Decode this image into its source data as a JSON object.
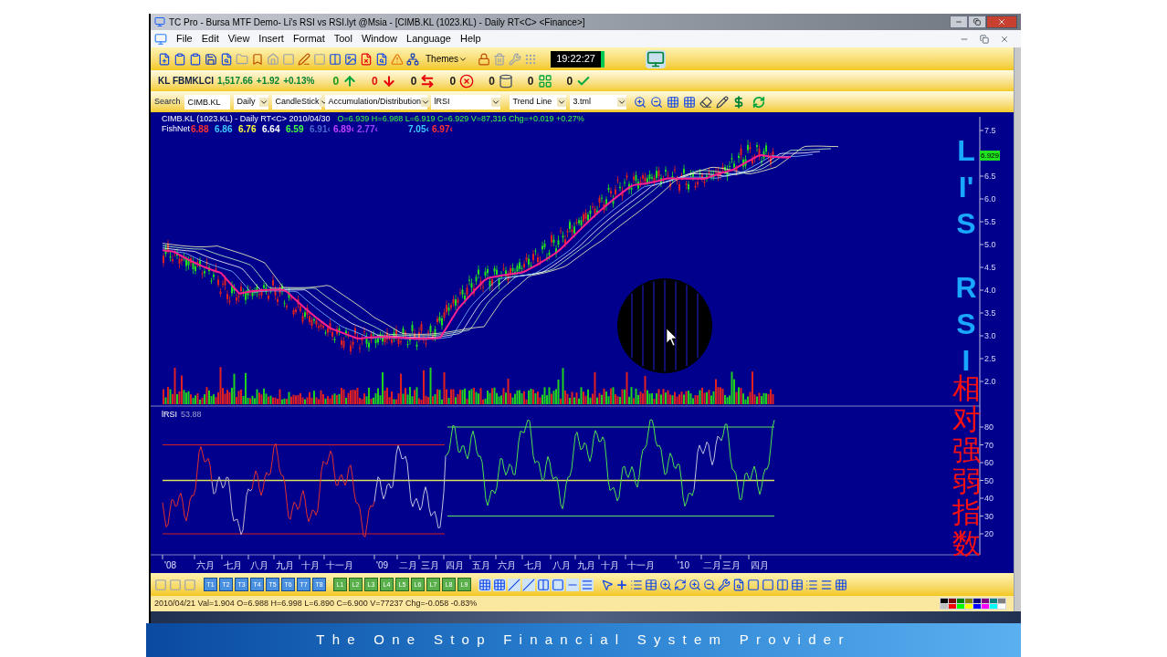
{
  "window": {
    "title": "TC Pro - Bursa MTF Demo- Li's RSI vs RSI.lyt @Msia - [CIMB.KL (1023.KL) - Daily RT<C> <Finance>]"
  },
  "menu": [
    "File",
    "Edit",
    "View",
    "Insert",
    "Format",
    "Tool",
    "Window",
    "Language",
    "Help"
  ],
  "toolbar": {
    "themes_label": "Themes",
    "clock": "19:22:27"
  },
  "ticker": {
    "index": "KL FBMKLCI",
    "value": "1,517.66",
    "change": "+1.92",
    "percent": "+0.13%",
    "counters": [
      {
        "count": "0",
        "kind": "up",
        "color": "#1a9a1a"
      },
      {
        "count": "0",
        "kind": "down",
        "color": "#e01010"
      },
      {
        "count": "0",
        "kind": "swap",
        "color": "#202020"
      },
      {
        "count": "0",
        "kind": "cancel",
        "color": "#202020"
      },
      {
        "count": "0",
        "kind": "can",
        "color": "#202020"
      },
      {
        "count": "0",
        "kind": "tile",
        "color": "#202020"
      },
      {
        "count": "0",
        "kind": "check",
        "color": "#202020"
      }
    ]
  },
  "chart_bar": {
    "search_label": "Search",
    "symbol": "CIMB.KL",
    "selects": [
      "Daily",
      "CandleStick",
      "Accumulation/Distribution",
      "lRSI",
      "Trend Line",
      "3.tml"
    ]
  },
  "chart": {
    "header": "CIMB.KL (1023.KL) - Daily RT<C>  2010/04/30",
    "quote": "O=6.939  H=6.988  L=6.919  C=6.929  V=87,316  Chg=+0.019  +0.27%",
    "fishnet_label": "FishNet",
    "fishnet_values": [
      {
        "text": "6.88",
        "color": "#ff3030"
      },
      {
        "text": "6.86",
        "color": "#40c8ff"
      },
      {
        "text": "6.76",
        "color": "#ffff40"
      },
      {
        "text": "6.64",
        "color": "#ffffff"
      },
      {
        "text": "6.59",
        "color": "#40ff40"
      },
      {
        "text": "6.91‹",
        "color": "#4a6ad0"
      },
      {
        "text": "6.89‹",
        "color": "#c040ff"
      },
      {
        "text": "2.77‹",
        "color": "#a040ff"
      },
      {
        "text": "7.05‹",
        "color": "#40c8ff"
      },
      {
        "text": "6.97‹",
        "color": "#ff3030"
      }
    ],
    "rsi_label": "lRSI",
    "rsi_value": "53.88",
    "price_ticks": [
      "7.5",
      "6.5",
      "6.0",
      "5.5",
      "5.0",
      "4.5",
      "4.0",
      "3.5",
      "3.0",
      "2.5",
      "2.0"
    ],
    "last_price": "6.929",
    "rsi_ticks": [
      "80",
      "70",
      "60",
      "50",
      "40",
      "30",
      "20"
    ],
    "x_labels": [
      "'08",
      "六月",
      "七月",
      "八月",
      "九月",
      "十月",
      "十一月",
      "'09",
      "二月",
      "三月",
      "四月",
      "五月",
      "六月",
      "七月",
      "八月",
      "九月",
      "十月",
      "十一月",
      "'10",
      "二月",
      "三月",
      "四月"
    ],
    "overlay_title": {
      "groups": [
        [
          "L",
          "I'",
          "S"
        ],
        [
          "R",
          "S",
          "I"
        ]
      ],
      "chinese": "相对强弱指数"
    }
  },
  "bottom_toolbar": {
    "t_buttons": [
      "T1",
      "T2",
      "T3",
      "T4",
      "T5",
      "T6",
      "T7",
      "T8"
    ],
    "l_buttons": [
      "L1",
      "L2",
      "L3",
      "L4",
      "L5",
      "L6",
      "L7",
      "L8",
      "L9"
    ]
  },
  "status_bar": {
    "text": "2010/04/21  Val=1.904  O=6.988  H=6.998  L=6.890  C=6.900  V=77237  Chg=-0.058  -0.83%",
    "palette": [
      {
        "color": "#000000"
      },
      {
        "color": "#800000"
      },
      {
        "color": "#008000"
      },
      {
        "color": "#808000"
      },
      {
        "color": "#000080"
      },
      {
        "color": "#800080"
      },
      {
        "color": "#008080"
      },
      {
        "color": "#808080"
      },
      {
        "color": "#c0c0c0"
      },
      {
        "color": "#ff0000"
      },
      {
        "color": "#00ff00"
      },
      {
        "color": "#ffff00"
      },
      {
        "color": "#0000ff"
      },
      {
        "color": "#ff00ff"
      },
      {
        "color": "#00ffff"
      },
      {
        "color": "#ffffff"
      }
    ]
  },
  "banner": {
    "text": "The One Stop Financial System Provider"
  }
}
